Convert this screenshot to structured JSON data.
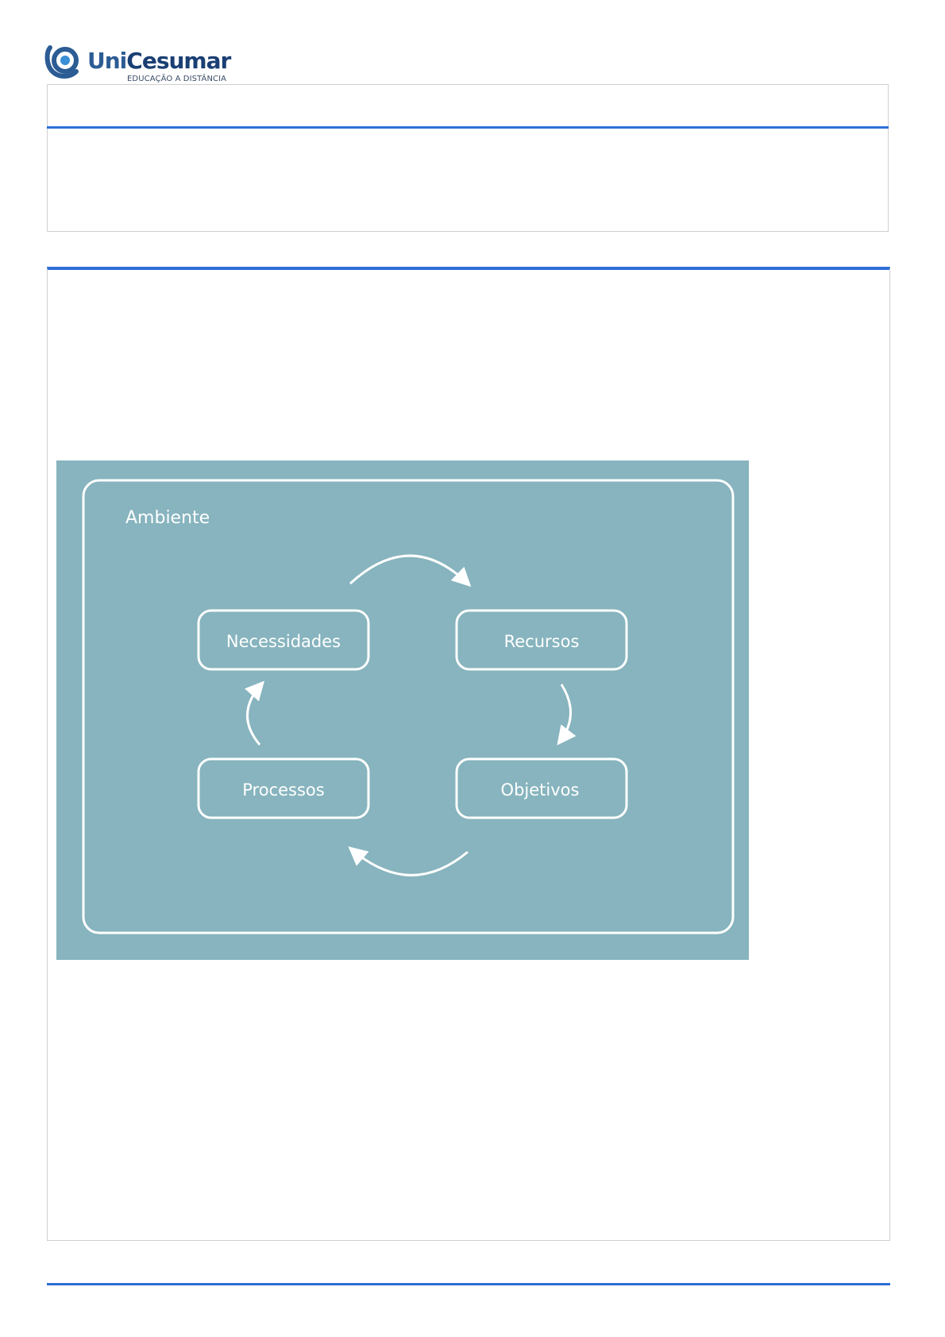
{
  "header": {
    "logo_word_a": "Uni",
    "logo_word_b": "Cesumar",
    "logo_tagline": "EDUCAÇÃO A DISTÂNCIA"
  },
  "diagram": {
    "container_label": "Ambiente",
    "nodes": {
      "necessidades": "Necessidades",
      "recursos": "Recursos",
      "objetivos": "Objetivos",
      "processos": "Processos"
    },
    "fill_color": "#87b4be",
    "line_color": "#ffffff"
  },
  "accent_color": "#2d6fd6"
}
